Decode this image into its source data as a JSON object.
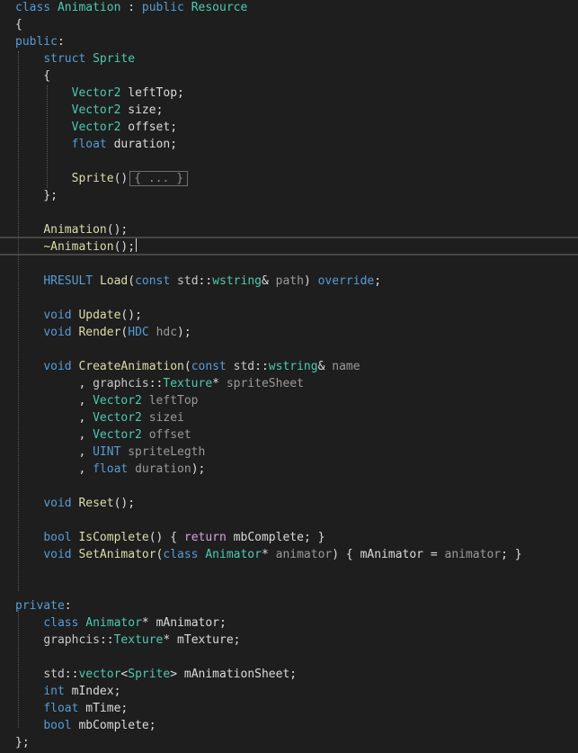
{
  "editor": {
    "collapsed_block": "{ ... }",
    "lines": [
      [
        [
          "class",
          "kw"
        ],
        [
          " "
        ],
        [
          "Animation",
          "type"
        ],
        [
          " : "
        ],
        [
          "public",
          "kw"
        ],
        [
          " "
        ],
        [
          "Resource",
          "type"
        ]
      ],
      [
        [
          "{"
        ]
      ],
      [
        [
          "public",
          "kw"
        ],
        [
          ":"
        ]
      ],
      [
        [
          "    "
        ],
        [
          "struct",
          "kw"
        ],
        [
          " "
        ],
        [
          "Sprite",
          "type"
        ]
      ],
      [
        [
          "    {"
        ]
      ],
      [
        [
          "        "
        ],
        [
          "Vector2",
          "type"
        ],
        [
          " "
        ],
        [
          "leftTop",
          "var"
        ],
        [
          ";"
        ]
      ],
      [
        [
          "        "
        ],
        [
          "Vector2",
          "type"
        ],
        [
          " "
        ],
        [
          "size",
          "var"
        ],
        [
          ";"
        ]
      ],
      [
        [
          "        "
        ],
        [
          "Vector2",
          "type"
        ],
        [
          " "
        ],
        [
          "offset",
          "var"
        ],
        [
          ";"
        ]
      ],
      [
        [
          "        "
        ],
        [
          "float",
          "kw"
        ],
        [
          " "
        ],
        [
          "duration",
          "var"
        ],
        [
          ";"
        ]
      ],
      [
        [
          ""
        ]
      ],
      [
        [
          "        "
        ],
        [
          "Sprite",
          "fn"
        ],
        [
          "()"
        ],
        [
          "{ ... }",
          "collapsed"
        ]
      ],
      [
        [
          "    };"
        ]
      ],
      [
        [
          ""
        ]
      ],
      [
        [
          "    "
        ],
        [
          "Animation",
          "fn"
        ],
        [
          "();"
        ]
      ],
      [
        [
          "    "
        ],
        [
          "~Animation",
          "fn"
        ],
        [
          "();"
        ]
      ],
      [
        [
          ""
        ]
      ],
      [
        [
          "    "
        ],
        [
          "HRESULT",
          "kw"
        ],
        [
          " "
        ],
        [
          "Load",
          "fn"
        ],
        [
          "("
        ],
        [
          "const",
          "kw"
        ],
        [
          " "
        ],
        [
          "std",
          "ns"
        ],
        [
          "::"
        ],
        [
          "wstring",
          "type"
        ],
        [
          "& "
        ],
        [
          "path",
          "param"
        ],
        [
          ") "
        ],
        [
          "override",
          "kw"
        ],
        [
          ";"
        ]
      ],
      [
        [
          ""
        ]
      ],
      [
        [
          "    "
        ],
        [
          "void",
          "kw"
        ],
        [
          " "
        ],
        [
          "Update",
          "fn"
        ],
        [
          "();"
        ]
      ],
      [
        [
          "    "
        ],
        [
          "void",
          "kw"
        ],
        [
          " "
        ],
        [
          "Render",
          "fn"
        ],
        [
          "("
        ],
        [
          "HDC",
          "kw"
        ],
        [
          " "
        ],
        [
          "hdc",
          "param"
        ],
        [
          ");"
        ]
      ],
      [
        [
          ""
        ]
      ],
      [
        [
          "    "
        ],
        [
          "void",
          "kw"
        ],
        [
          " "
        ],
        [
          "CreateAnimation",
          "fn"
        ],
        [
          "("
        ],
        [
          "const",
          "kw"
        ],
        [
          " "
        ],
        [
          "std",
          "ns"
        ],
        [
          "::"
        ],
        [
          "wstring",
          "type"
        ],
        [
          "& "
        ],
        [
          "name",
          "param"
        ]
      ],
      [
        [
          "         , "
        ],
        [
          "graphcis",
          "ns"
        ],
        [
          "::"
        ],
        [
          "Texture",
          "type"
        ],
        [
          "* "
        ],
        [
          "spriteSheet",
          "param"
        ]
      ],
      [
        [
          "         , "
        ],
        [
          "Vector2",
          "type"
        ],
        [
          " "
        ],
        [
          "leftTop",
          "param"
        ]
      ],
      [
        [
          "         , "
        ],
        [
          "Vector2",
          "type"
        ],
        [
          " "
        ],
        [
          "sizei",
          "param"
        ]
      ],
      [
        [
          "         , "
        ],
        [
          "Vector2",
          "type"
        ],
        [
          " "
        ],
        [
          "offset",
          "param"
        ]
      ],
      [
        [
          "         , "
        ],
        [
          "UINT",
          "kw"
        ],
        [
          " "
        ],
        [
          "spriteLegth",
          "param"
        ]
      ],
      [
        [
          "         , "
        ],
        [
          "float",
          "kw"
        ],
        [
          " "
        ],
        [
          "duration",
          "param"
        ],
        [
          ");"
        ]
      ],
      [
        [
          ""
        ]
      ],
      [
        [
          "    "
        ],
        [
          "void",
          "kw"
        ],
        [
          " "
        ],
        [
          "Reset",
          "fn"
        ],
        [
          "();"
        ]
      ],
      [
        [
          ""
        ]
      ],
      [
        [
          "    "
        ],
        [
          "bool",
          "kw"
        ],
        [
          " "
        ],
        [
          "IsComplete",
          "fn"
        ],
        [
          "() { "
        ],
        [
          "return",
          "kw2"
        ],
        [
          " "
        ],
        [
          "mbComplete",
          "mem"
        ],
        [
          "; }"
        ]
      ],
      [
        [
          "    "
        ],
        [
          "void",
          "kw"
        ],
        [
          " "
        ],
        [
          "SetAnimator",
          "fn"
        ],
        [
          "("
        ],
        [
          "class",
          "kw"
        ],
        [
          " "
        ],
        [
          "Animator",
          "type"
        ],
        [
          "* "
        ],
        [
          "animator",
          "param"
        ],
        [
          ") { "
        ],
        [
          "mAnimator",
          "mem"
        ],
        [
          " = "
        ],
        [
          "animator",
          "param"
        ],
        [
          "; }"
        ]
      ],
      [
        [
          ""
        ]
      ],
      [
        [
          ""
        ]
      ],
      [
        [
          "private",
          "kw"
        ],
        [
          ":"
        ]
      ],
      [
        [
          "    "
        ],
        [
          "class",
          "kw"
        ],
        [
          " "
        ],
        [
          "Animator",
          "type"
        ],
        [
          "* "
        ],
        [
          "mAnimator",
          "mem"
        ],
        [
          ";"
        ]
      ],
      [
        [
          "    "
        ],
        [
          "graphcis",
          "ns"
        ],
        [
          "::"
        ],
        [
          "Texture",
          "type"
        ],
        [
          "* "
        ],
        [
          "mTexture",
          "mem"
        ],
        [
          ";"
        ]
      ],
      [
        [
          ""
        ]
      ],
      [
        [
          "    "
        ],
        [
          "std",
          "ns"
        ],
        [
          "::"
        ],
        [
          "vector",
          "type"
        ],
        [
          "<"
        ],
        [
          "Sprite",
          "type"
        ],
        [
          "> "
        ],
        [
          "mAnimationSheet",
          "mem"
        ],
        [
          ";"
        ]
      ],
      [
        [
          "    "
        ],
        [
          "int",
          "kw"
        ],
        [
          " "
        ],
        [
          "mIndex",
          "mem"
        ],
        [
          ";"
        ]
      ],
      [
        [
          "    "
        ],
        [
          "float",
          "kw"
        ],
        [
          " "
        ],
        [
          "mTime",
          "mem"
        ],
        [
          ";"
        ]
      ],
      [
        [
          "    "
        ],
        [
          "bool",
          "kw"
        ],
        [
          " "
        ],
        [
          "mbComplete",
          "mem"
        ],
        [
          ";"
        ]
      ],
      [
        [
          "};"
        ]
      ]
    ]
  }
}
